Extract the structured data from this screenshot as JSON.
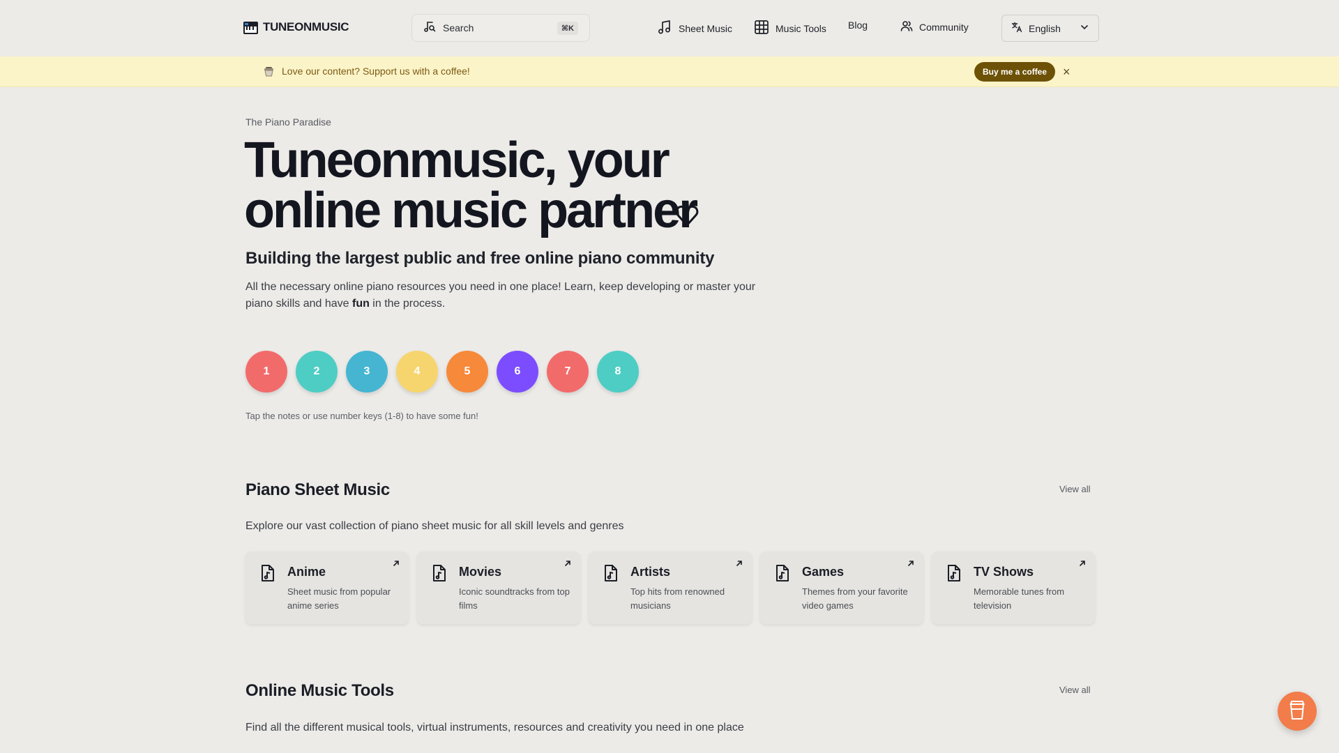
{
  "header": {
    "logo_text": "TUNEONMUSIC",
    "search_label": "Search",
    "search_shortcut": "⌘K",
    "nav": [
      {
        "label": "Sheet Music",
        "icon": "music-note-icon"
      },
      {
        "label": "Music Tools",
        "icon": "grid-icon"
      },
      {
        "label": "Blog"
      },
      {
        "label": "Community",
        "icon": "users-icon"
      }
    ],
    "language": "English"
  },
  "banner": {
    "text": "Love our content? Support us with a coffee!",
    "button_label": "Buy me a coffee",
    "close_label": "×"
  },
  "hero": {
    "eyebrow": "The Piano Paradise",
    "title_line1": "Tuneonmusic, your",
    "title_line2": "online music partner",
    "subtitle": "Building the largest public and free online piano community",
    "desc_before": "All the necessary online piano resources you need in one place! Learn, keep developing or master your piano skills and have ",
    "desc_bold": "fun",
    "desc_after": " in the process.",
    "notes": [
      {
        "label": "1",
        "color": "#f26b6b"
      },
      {
        "label": "2",
        "color": "#4ecdc4"
      },
      {
        "label": "3",
        "color": "#45b5d1"
      },
      {
        "label": "4",
        "color": "#f7d56e"
      },
      {
        "label": "5",
        "color": "#f7893b"
      },
      {
        "label": "6",
        "color": "#7c4dff"
      },
      {
        "label": "7",
        "color": "#f26b6b"
      },
      {
        "label": "8",
        "color": "#4ecdc4"
      }
    ],
    "notes_hint": "Tap the notes or use number keys (1-8) to have some fun!"
  },
  "sheet_music": {
    "title": "Piano Sheet Music",
    "view_all": "View all",
    "desc": "Explore our vast collection of piano sheet music for all skill levels and genres",
    "cards": [
      {
        "title": "Anime",
        "desc": "Sheet music from popular anime series"
      },
      {
        "title": "Movies",
        "desc": "Iconic soundtracks from top films"
      },
      {
        "title": "Artists",
        "desc": "Top hits from renowned musicians"
      },
      {
        "title": "Games",
        "desc": "Themes from your favorite video games"
      },
      {
        "title": "TV Shows",
        "desc": "Memorable tunes from television"
      }
    ]
  },
  "tools": {
    "title": "Online Music Tools",
    "view_all": "View all",
    "desc": "Find all the different musical tools, virtual instruments, resources and creativity you need in one place"
  },
  "colors": {
    "background": "#ecebe8",
    "banner_bg": "#fcf4c9",
    "coffee_button": "#6d5106",
    "fab": "#f27c4a"
  }
}
